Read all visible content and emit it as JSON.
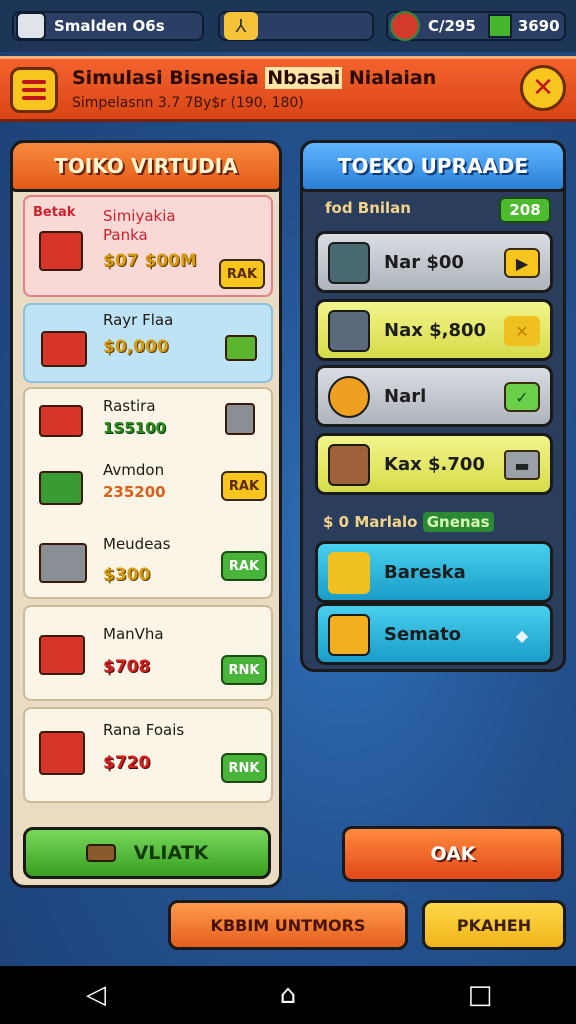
{
  "statusbar": {
    "player_label": "Smalden O6s",
    "currency": "C/295",
    "energy": "3690"
  },
  "header": {
    "title_part1": "Simulasi Bisnesia ",
    "title_part2": "Nbasai",
    "title_part3": " Nialaian",
    "subtitle": "Simpelasnn 3.7 7By$r (190, 180)"
  },
  "left_panel": {
    "title": "TOIKO VIRTUDIA",
    "items": [
      {
        "tag": "Betak",
        "name": "Simiyakia Panka",
        "price": "$07 $00M",
        "button": "RAK"
      },
      {
        "name": "Rayr Flaa",
        "price": "$0,000"
      },
      {
        "name": "Rastira",
        "price": "1S5100"
      },
      {
        "name": "Avmdon",
        "price": "235200",
        "button": "RAK"
      },
      {
        "name": "Meudeas",
        "price": "$300",
        "button": "RAK"
      },
      {
        "name": "ManVha",
        "price": "$708",
        "button": "RNK"
      },
      {
        "name": "Rana Foais",
        "price": "$720",
        "button": "RNK"
      }
    ],
    "bottom_button": "VLIATK"
  },
  "right_panel": {
    "title": "TOEKO UPRAADE",
    "subtitle": "fod Bnilan",
    "badge": "208",
    "rows": [
      {
        "label": "Nar $00"
      },
      {
        "label": "Nax $,800"
      },
      {
        "label": "Narl"
      },
      {
        "label": "Kax $.700"
      }
    ],
    "mid_label": "$ 0 Marlalo",
    "mid_tag": "Gnenas",
    "cyan_rows": [
      {
        "label": "Bareska"
      },
      {
        "label": "Semato"
      }
    ]
  },
  "buttons": {
    "oak": "OAK",
    "kebim": "KBBIM UNTMORS",
    "pkaver": "PKAHEH"
  },
  "colors": {
    "banner": "#e25b17",
    "left_head": "#f88a3c",
    "right_head": "#2a7fd8",
    "accent_green": "#48b43a",
    "accent_yellow": "#f7c51e"
  }
}
